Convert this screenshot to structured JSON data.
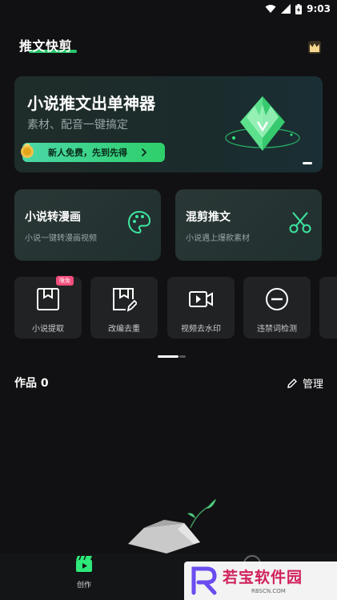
{
  "status": {
    "time": "9:03"
  },
  "header": {
    "title": "推文快剪"
  },
  "banner": {
    "title": "小说推文出单神器",
    "subtitle": "素材、配音一键搞定",
    "pill_text": "新人免费，先到先得"
  },
  "feature_cards": [
    {
      "title": "小说转漫画",
      "subtitle": "小说一键转漫画视频",
      "icon": "palette-icon"
    },
    {
      "title": "混剪推文",
      "subtitle": "小说遇上爆款素材",
      "icon": "scissors-icon"
    }
  ],
  "tools": [
    {
      "label": "小说提取",
      "icon": "book-extract-icon",
      "badge": "限免"
    },
    {
      "label": "改编去重",
      "icon": "edit-dedupe-icon"
    },
    {
      "label": "视频去水印",
      "icon": "video-watermark-icon"
    },
    {
      "label": "违禁词检测",
      "icon": "forbidden-word-icon"
    }
  ],
  "works": {
    "title": "作品 0",
    "manage_label": "管理"
  },
  "nav": {
    "create_label": "创作"
  },
  "watermark": {
    "text": "若宝软件园",
    "sub": "RBSCN.COM"
  },
  "colors": {
    "accent": "#2ee87a",
    "badge": "#f24d7c",
    "background": "#111113"
  }
}
